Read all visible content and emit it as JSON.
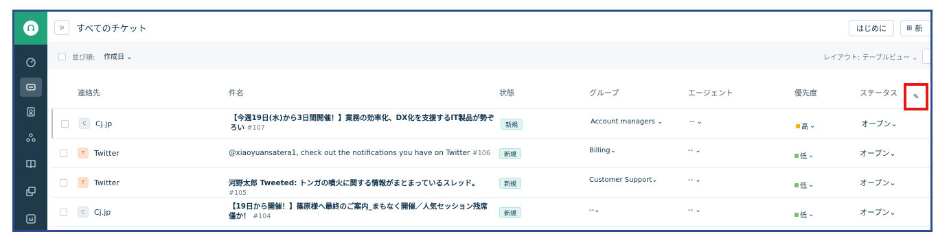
{
  "header": {
    "title": "すべてのチケット",
    "intro_button": "はじめに",
    "new_button": "新"
  },
  "sortbar": {
    "sort_label": "並び順:",
    "sort_value": "作成日",
    "layout_label": "レイアウト: テーブルビュー"
  },
  "columns": {
    "contact": "連絡先",
    "subject": "件名",
    "state": "状態",
    "group": "グループ",
    "agent": "エージェント",
    "priority": "優先度",
    "status": "ステータス"
  },
  "rows": [
    {
      "avatar": "C",
      "contact": "Cj.jp",
      "subject": "【今週19日(水)から3日間開催！】業務の効率化、DX化を支援するIT製品が勢ぞろい",
      "number": "#107",
      "state": "新規",
      "group": "Account managers",
      "agent": "--",
      "priority": "高",
      "priority_color": "#f7b500",
      "status": "オープン"
    },
    {
      "avatar": "T",
      "contact": "Twitter",
      "subject": "@xiaoyuansatera1, check out the notifications you have on Twitter",
      "number": "#106",
      "state": "新規",
      "group": "Billing",
      "agent": "--",
      "priority": "低",
      "priority_color": "#76c26b",
      "status": "オープン"
    },
    {
      "avatar": "T",
      "contact": "Twitter",
      "subject": "河野太郎 Tweeted: トンガの噴火に関する情報がまとまっているスレッド。",
      "number": "#105",
      "state": "新規",
      "group": "Customer Support",
      "agent": "--",
      "priority": "低",
      "priority_color": "#76c26b",
      "status": "オープン"
    },
    {
      "avatar": "C",
      "contact": "Cj.jp",
      "subject": "【19日から開催！】篠原様へ最終のご案内_まもなく開催／人気セッション残席僅か！",
      "number": "#104",
      "state": "新規",
      "group": "--",
      "agent": "--",
      "priority": "低",
      "priority_color": "#76c26b",
      "status": "オープン"
    }
  ],
  "icons": {
    "caret": "⌄",
    "edit": "✎"
  },
  "colors": {
    "brand_green": "#23a37c",
    "sidebar": "#1f3a4b",
    "highlight": "#e51818"
  }
}
